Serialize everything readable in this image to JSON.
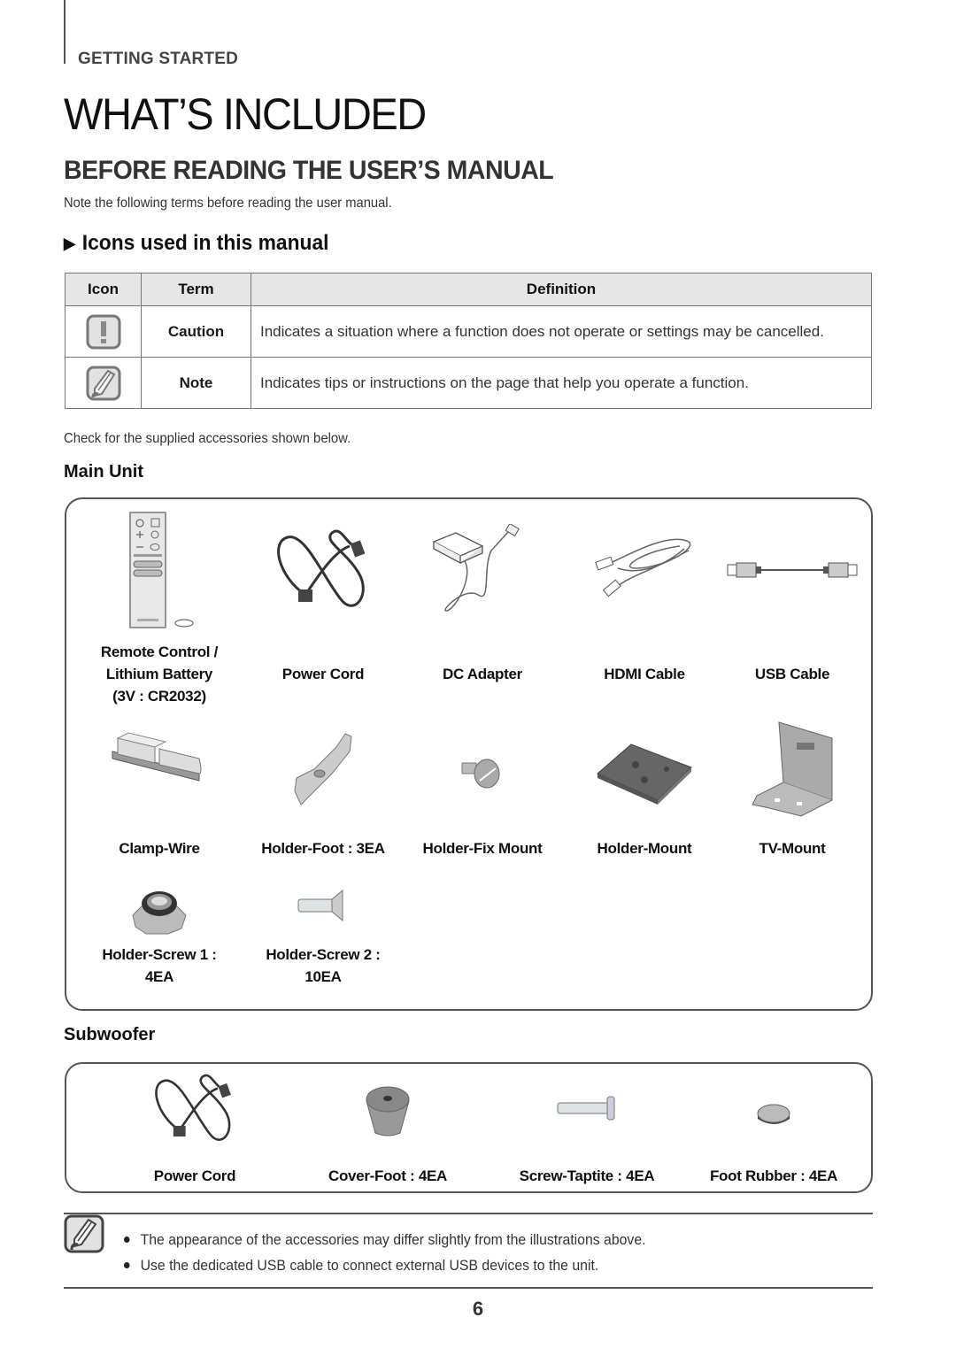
{
  "header": {
    "section": "GETTING STARTED",
    "title": "WHAT’S INCLUDED"
  },
  "before_reading": {
    "title": "BEFORE READING THE USER’S MANUAL",
    "intro": "Note the following terms before reading the user manual.",
    "icons_heading": "Icons used in this manual",
    "table": {
      "columns": [
        "Icon",
        "Term",
        "Definition"
      ],
      "rows": [
        {
          "icon": "caution-icon",
          "term": "Caution",
          "definition": "Indicates a situation where a function does not operate or settings may be cancelled."
        },
        {
          "icon": "note-icon",
          "term": "Note",
          "definition": "Indicates tips or instructions on the page that help you operate a function."
        }
      ]
    }
  },
  "accessories": {
    "intro": "Check for the supplied accessories shown below.",
    "main_unit": {
      "heading": "Main Unit",
      "items": [
        {
          "lines": [
            "Remote Control /",
            "Lithium Battery",
            "(3V : CR2032)"
          ],
          "icon": "remote-control-icon"
        },
        {
          "lines": [
            "Power Cord"
          ],
          "icon": "power-cord-icon"
        },
        {
          "lines": [
            "DC Adapter"
          ],
          "icon": "dc-adapter-icon"
        },
        {
          "lines": [
            "HDMI Cable"
          ],
          "icon": "hdmi-cable-icon"
        },
        {
          "lines": [
            "USB Cable"
          ],
          "icon": "usb-cable-icon"
        },
        {
          "lines": [
            "Clamp-Wire"
          ],
          "icon": "clamp-wire-icon"
        },
        {
          "lines": [
            "Holder-Foot : 3EA"
          ],
          "icon": "holder-foot-icon"
        },
        {
          "lines": [
            "Holder-Fix Mount"
          ],
          "icon": "holder-fix-mount-icon"
        },
        {
          "lines": [
            "Holder-Mount"
          ],
          "icon": "holder-mount-icon"
        },
        {
          "lines": [
            "TV-Mount"
          ],
          "icon": "tv-mount-icon"
        },
        {
          "lines": [
            "Holder-Screw 1 :",
            "4EA"
          ],
          "icon": "holder-screw-1-icon"
        },
        {
          "lines": [
            "Holder-Screw 2 :",
            "10EA"
          ],
          "icon": "holder-screw-2-icon"
        }
      ]
    },
    "subwoofer": {
      "heading": "Subwoofer",
      "items": [
        {
          "lines": [
            "Power Cord"
          ],
          "icon": "power-cord-icon"
        },
        {
          "lines": [
            "Cover-Foot : 4EA"
          ],
          "icon": "cover-foot-icon"
        },
        {
          "lines": [
            "Screw-Taptite : 4EA"
          ],
          "icon": "screw-taptite-icon"
        },
        {
          "lines": [
            "Foot Rubber : 4EA"
          ],
          "icon": "foot-rubber-icon"
        }
      ]
    }
  },
  "notes": [
    "The appearance of the accessories may differ slightly from the illustrations above.",
    "Use the dedicated USB cable to connect external USB devices to the unit."
  ],
  "page_number": "6"
}
